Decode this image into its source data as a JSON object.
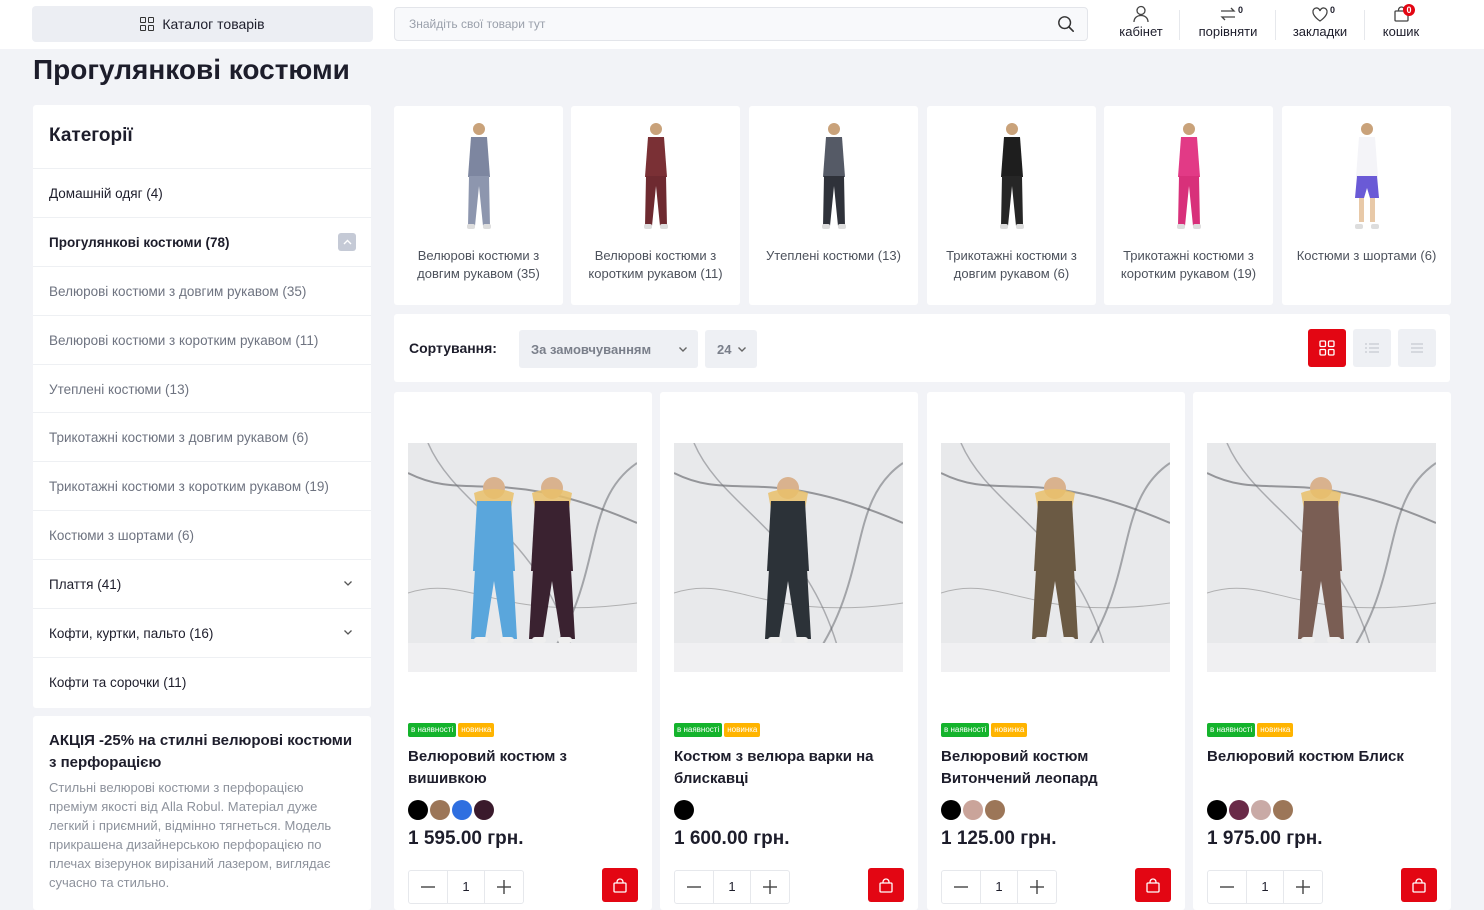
{
  "header": {
    "catalog_label": "Каталог товарів",
    "search_placeholder": "Знайдіть свої товари тут",
    "account_label": "кабінет",
    "compare_label": "порівняти",
    "compare_count": "0",
    "wishlist_label": "закладки",
    "wishlist_count": "0",
    "cart_label": "кошик",
    "cart_count": "0"
  },
  "page_title": "Прогулянкові костюми",
  "sidebar": {
    "title": "Категорії",
    "items": [
      {
        "label": "Домашній одяг (4)"
      },
      {
        "label": "Прогулянкові костюми (78)"
      },
      {
        "label": "Велюрові костюми з довгим рукавом (35)"
      },
      {
        "label": "Велюрові костюми з коротким рукавом (11)"
      },
      {
        "label": "Утеплені костюми (13)"
      },
      {
        "label": "Трикотажні костюми з довгим рукавом (6)"
      },
      {
        "label": "Трикотажні костюми з коротким рукавом (19)"
      },
      {
        "label": "Костюми з шортами (6)"
      },
      {
        "label": "Плаття (41)"
      },
      {
        "label": "Кофти, куртки, пальто (16)"
      },
      {
        "label": "Кофти та сорочки (11)"
      }
    ]
  },
  "promo": {
    "title": "АКЦІЯ -25% на стилні велюрові костюми з перфорацією",
    "text": "Стильні велюрові костюми з перфорацією преміум якості від Alla Robul. Матеріал дуже легкий і приємний, відмінно тягнеться. Модель прикрашена дизайнерською перфорацією по плечах візерунок вирізаний лазером, виглядає сучасно та стильно."
  },
  "subcategories": [
    {
      "label": "Велюрові костюми з довгим рукавом (35)",
      "top": "#7d86a0",
      "bottom": "#8d96ae"
    },
    {
      "label": "Велюрові костюми з коротким рукавом (11)",
      "top": "#7a3035",
      "bottom": "#6e2a30"
    },
    {
      "label": "Утеплені костюми (13)",
      "top": "#555a66",
      "bottom": "#2f323a"
    },
    {
      "label": "Трикотажні костюми з довгим рукавом (6)",
      "top": "#1e1e1e",
      "bottom": "#262626"
    },
    {
      "label": "Трикотажні костюми з коротким рукавом (19)",
      "top": "#e23a86",
      "bottom": "#d8307a"
    },
    {
      "label": "Костюми з шортами (6)",
      "top": "#f4f4f8",
      "bottom": "#6a5ad6"
    }
  ],
  "sort": {
    "label": "Сортування:",
    "selected": "За замовчуванням",
    "per_page": "24"
  },
  "badges": {
    "in_stock": "в наявності",
    "new": "новинка"
  },
  "products": [
    {
      "name": "Велюровий костюм з вишивкою",
      "price": "1 595.00 грн.",
      "qty": "1",
      "swatches": [
        "#000000",
        "#9c7658",
        "#2f6fe0",
        "#3a1a2c"
      ],
      "outfits": [
        "#5aa6dc",
        "#3a2230"
      ]
    },
    {
      "name": "Костюм з велюра варки на блискавці",
      "price": "1 600.00 грн.",
      "qty": "1",
      "swatches": [
        "#000000"
      ],
      "outfits": [
        "#2c3238"
      ]
    },
    {
      "name": "Велюровий костюм Витончений леопард",
      "price": "1 125.00 грн.",
      "qty": "1",
      "swatches": [
        "#000000",
        "#caa49a",
        "#9c7658"
      ],
      "outfits": [
        "#6b5a44"
      ]
    },
    {
      "name": "Велюровий костюм Блиск",
      "price": "1 975.00 грн.",
      "qty": "1",
      "swatches": [
        "#000000",
        "#6a2a48",
        "#c9aaa6",
        "#9c7658"
      ],
      "outfits": [
        "#7a5e54"
      ]
    }
  ],
  "colors": {
    "accent": "#e30613",
    "in_stock": "#14b32c",
    "new": "#ffb400"
  }
}
